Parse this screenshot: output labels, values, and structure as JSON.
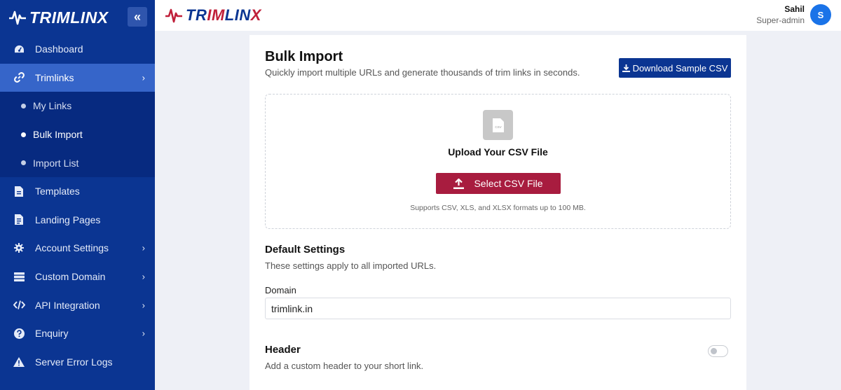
{
  "brand": {
    "part1": "TR",
    "part2": "IM",
    "part3": "LIN",
    "part4": "X",
    "collapse_icon": "«"
  },
  "sidebar": {
    "items": [
      {
        "label": "Dashboard",
        "icon": "speedometer-icon"
      },
      {
        "label": "Trimlinks",
        "icon": "link-icon",
        "chevron": "›"
      },
      {
        "label": "Templates",
        "icon": "file-icon"
      },
      {
        "label": "Landing Pages",
        "icon": "file-text-icon"
      },
      {
        "label": "Account Settings",
        "icon": "gear-icon",
        "chevron": "›"
      },
      {
        "label": "Custom Domain",
        "icon": "server-icon",
        "chevron": "›"
      },
      {
        "label": "API Integration",
        "icon": "code-icon",
        "chevron": "›"
      },
      {
        "label": "Enquiry",
        "icon": "question-icon",
        "chevron": "›"
      },
      {
        "label": "Server Error Logs",
        "icon": "warning-icon"
      }
    ],
    "sub_items": [
      {
        "label": "My Links"
      },
      {
        "label": "Bulk Import"
      },
      {
        "label": "Import List"
      }
    ]
  },
  "user": {
    "name": "Sahil",
    "role": "Super-admin",
    "initial": "S"
  },
  "page": {
    "title": "Bulk Import",
    "subtitle": "Quickly import multiple URLs and generate thousands of trim links in seconds.",
    "download_label": "Download Sample CSV",
    "upload_title": "Upload Your CSV File",
    "select_label": "Select CSV File",
    "upload_note": "Supports CSV, XLS, and XLSX formats up to 100 MB.",
    "file_icon_label": "CSV"
  },
  "defaults": {
    "title": "Default Settings",
    "desc": "These settings apply to all imported URLs.",
    "domain_label": "Domain",
    "domain_value": "trimlink.in"
  },
  "header_setting": {
    "title": "Header",
    "desc": "Add a custom header to your short link.",
    "enabled": false
  },
  "colors": {
    "sidebar": "#0b3592",
    "active": "#3665c9",
    "accent": "#a81c3f",
    "primary": "#0b3592"
  }
}
